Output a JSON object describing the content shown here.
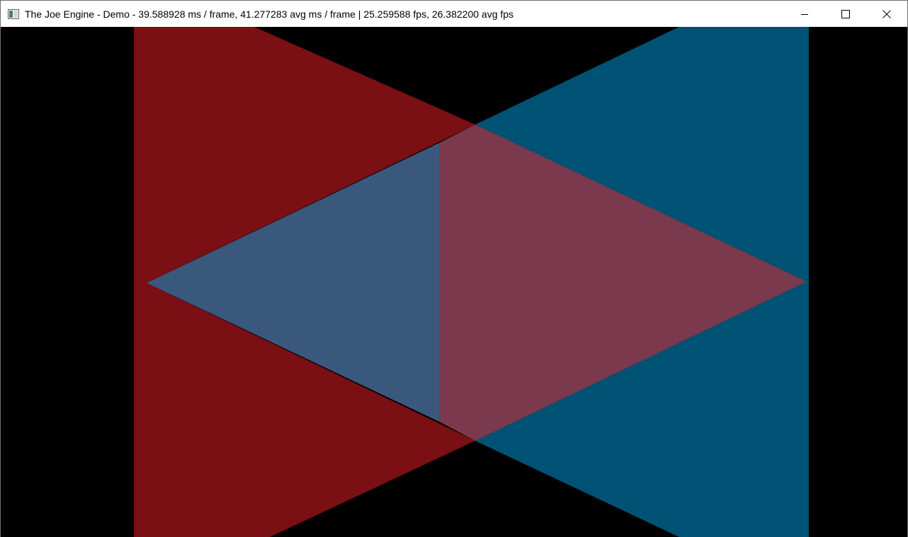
{
  "window": {
    "title": "The Joe Engine - Demo - 39.588928 ms / frame, 41.277283 avg ms / frame | 25.259588 fps, 26.382200 avg fps",
    "controls": {
      "minimize_icon": "minimize-icon",
      "maximize_icon": "maximize-icon",
      "close_icon": "close-icon"
    }
  },
  "scene": {
    "background_color": "#000000",
    "colors": {
      "red_quad": "#7a0f14",
      "blue_quad": "#005274",
      "left_overlap": "#3a587b",
      "center_overlap": "#7a394d"
    }
  }
}
